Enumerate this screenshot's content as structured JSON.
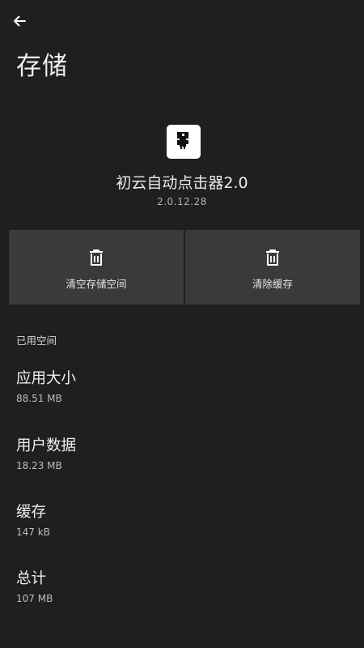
{
  "header": {
    "back_icon": "arrow-back-icon",
    "title": "存储"
  },
  "app": {
    "icon": "app-logo-icon",
    "name": "初云自动点击器2.0",
    "version": "2.0.12.28"
  },
  "actions": [
    {
      "icon": "trash-icon",
      "label": "清空存储空间"
    },
    {
      "icon": "trash-icon",
      "label": "清除缓存"
    }
  ],
  "section": {
    "title": "已用空间"
  },
  "stats": [
    {
      "title": "应用大小",
      "value": "88.51 MB"
    },
    {
      "title": "用户数据",
      "value": "18.23 MB"
    },
    {
      "title": "缓存",
      "value": "147 kB"
    },
    {
      "title": "总计",
      "value": "107 MB"
    }
  ]
}
